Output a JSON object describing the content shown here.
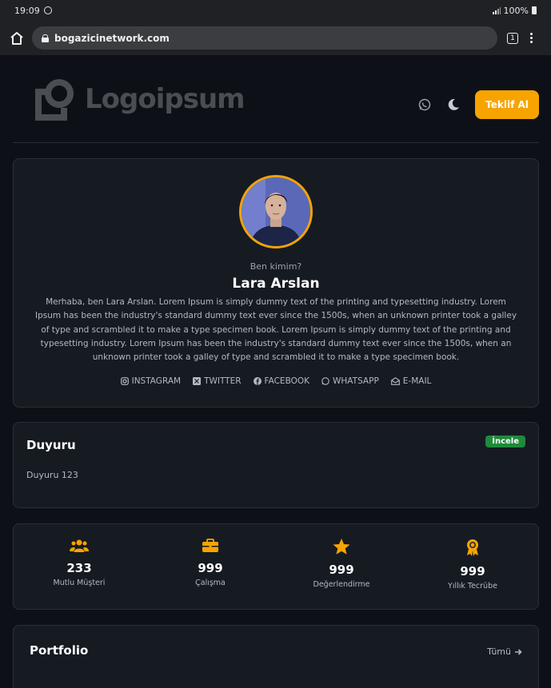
{
  "status_bar": {
    "time": "19:09",
    "battery": "100%"
  },
  "browser": {
    "url": "bogazicinetwork.com",
    "tab_count": "1"
  },
  "header": {
    "logo_text": "Logoipsum",
    "cta_label": "Teklif Al"
  },
  "profile": {
    "kicker": "Ben kimim?",
    "name": "Lara Arslan",
    "bio": "Merhaba, ben Lara Arslan. Lorem Ipsum is simply dummy text of the printing and typesetting industry. Lorem Ipsum has been the industry's standard dummy text ever since the 1500s, when an unknown printer took a galley of type and scrambled it to make a type specimen book. Lorem Ipsum is simply dummy text of the printing and typesetting industry. Lorem Ipsum has been the industry's standard dummy text ever since the 1500s, when an unknown printer took a galley of type and scrambled it to make a type specimen book.",
    "socials": [
      {
        "label": "INSTAGRAM",
        "icon": "instagram-icon"
      },
      {
        "label": "TWITTER",
        "icon": "twitter-icon"
      },
      {
        "label": "FACEBOOK",
        "icon": "facebook-icon"
      },
      {
        "label": "WHATSAPP",
        "icon": "whatsapp-icon"
      },
      {
        "label": "E-MAIL",
        "icon": "mail-icon"
      }
    ]
  },
  "announcement": {
    "title": "Duyuru",
    "badge": "İncele",
    "text": "Duyuru 123"
  },
  "stats": [
    {
      "value": "233",
      "label": "Mutlu Müşteri",
      "icon": "users-icon"
    },
    {
      "value": "999",
      "label": "Çalışma",
      "icon": "briefcase-icon"
    },
    {
      "value": "999",
      "label": "Değerlendirme",
      "icon": "star-icon"
    },
    {
      "value": "999",
      "label": "Yıllık Tecrübe",
      "icon": "award-icon"
    }
  ],
  "portfolio": {
    "title": "Portfolio",
    "all_label": "Tümü"
  },
  "colors": {
    "accent": "#f7a400",
    "badge": "#1f8a3b",
    "background": "#0d1117",
    "card": "#161b22"
  }
}
